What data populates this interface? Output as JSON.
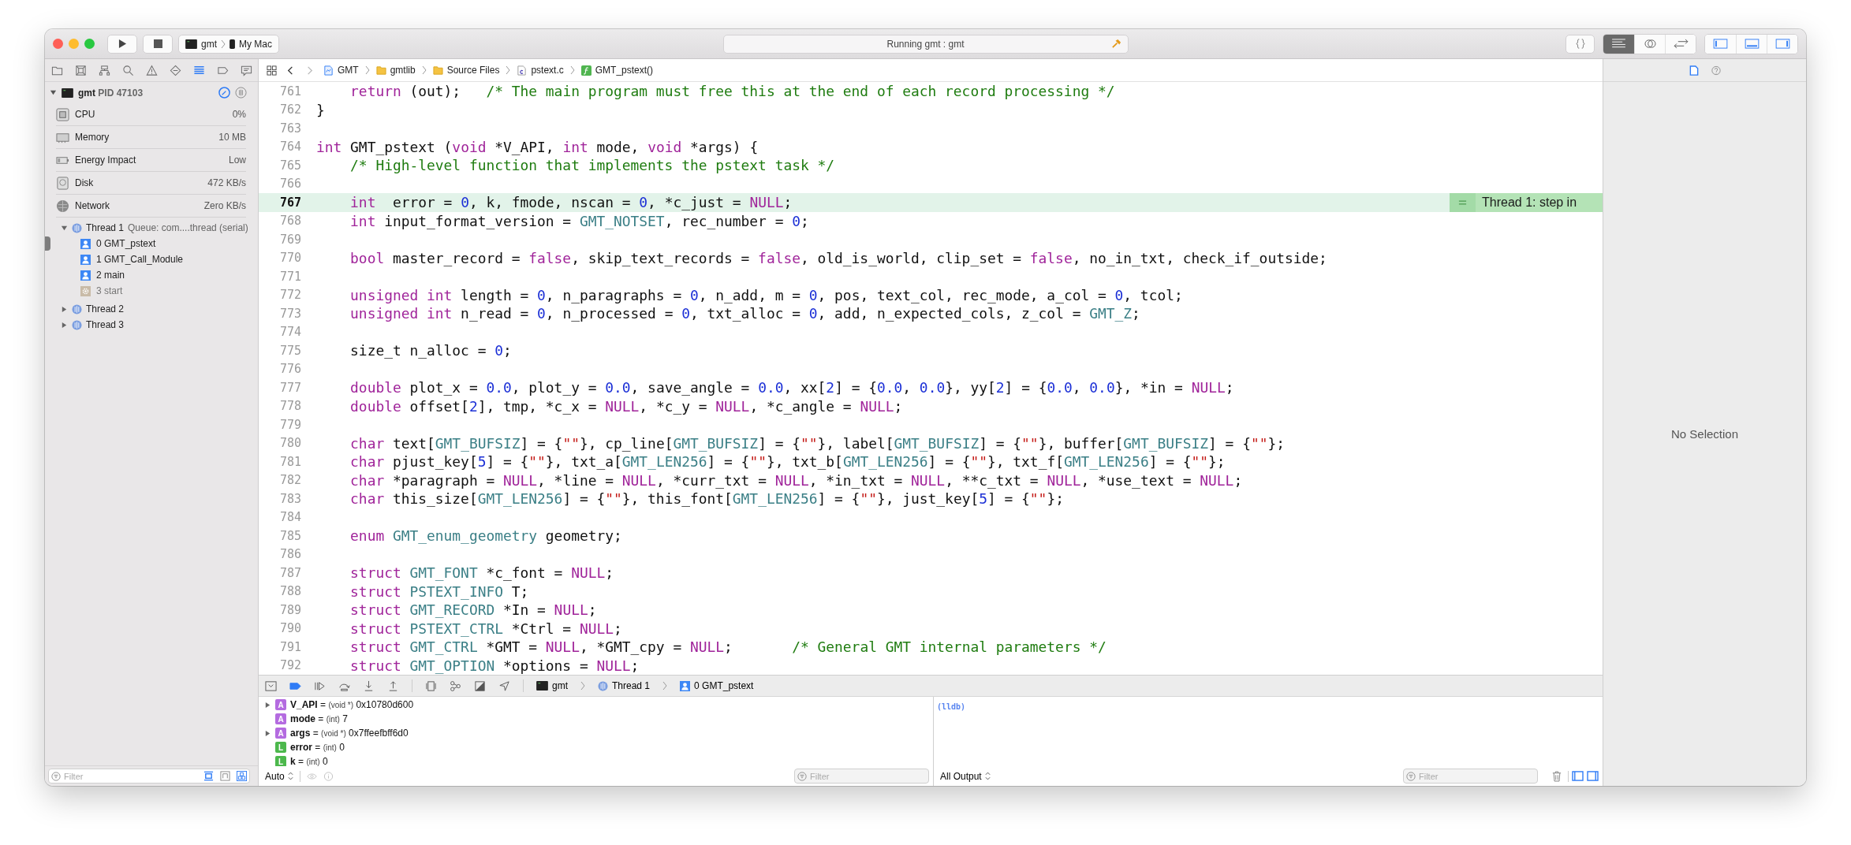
{
  "toolbar": {
    "scheme": {
      "target": "gmt",
      "destination": "My Mac"
    },
    "activity": "Running gmt : gmt",
    "editor_modes": [
      {
        "kind": "standard",
        "selected": true
      },
      {
        "kind": "assistant",
        "selected": false
      },
      {
        "kind": "version",
        "selected": false
      }
    ],
    "panels": [
      {
        "kind": "navigator",
        "on": true
      },
      {
        "kind": "debug",
        "on": true
      },
      {
        "kind": "inspector",
        "on": true
      }
    ]
  },
  "navigator": {
    "tabs": [
      {
        "kind": "project",
        "selected": false
      },
      {
        "kind": "source-control",
        "selected": false
      },
      {
        "kind": "symbol",
        "selected": false
      },
      {
        "kind": "find",
        "selected": false
      },
      {
        "kind": "issue",
        "selected": false
      },
      {
        "kind": "test",
        "selected": false
      },
      {
        "kind": "debug",
        "selected": true
      },
      {
        "kind": "breakpoint",
        "selected": false
      },
      {
        "kind": "report",
        "selected": false
      }
    ],
    "process": {
      "name": "gmt",
      "pid": "PID 47103"
    },
    "gauges": [
      {
        "kind": "cpu",
        "label": "CPU",
        "value": "0%"
      },
      {
        "kind": "memory",
        "label": "Memory",
        "value": "10 MB"
      },
      {
        "kind": "energy",
        "label": "Energy Impact",
        "value": "Low"
      },
      {
        "kind": "disk",
        "label": "Disk",
        "value": "472 KB/s"
      },
      {
        "kind": "network",
        "label": "Network",
        "value": "Zero KB/s"
      }
    ],
    "threads": [
      {
        "name": "Thread 1",
        "detail": "Queue: com....thread (serial)",
        "expanded": true,
        "frames": [
          {
            "label": "0 GMT_pstext",
            "kind": "user",
            "current": true
          },
          {
            "label": "1 GMT_Call_Module",
            "kind": "user",
            "current": false
          },
          {
            "label": "2 main",
            "kind": "user",
            "current": false
          },
          {
            "label": "3 start",
            "kind": "system",
            "current": false
          }
        ]
      },
      {
        "name": "Thread 2",
        "expanded": false
      },
      {
        "name": "Thread 3",
        "expanded": false
      }
    ],
    "filter": {
      "placeholder": "Filter"
    },
    "filter_options": [
      {
        "kind": "crashed",
        "on": true
      },
      {
        "kind": "running",
        "on": false
      },
      {
        "kind": "grouped",
        "on": true
      }
    ]
  },
  "jump_bar": {
    "back_enabled": true,
    "forward_enabled": false,
    "crumbs": [
      {
        "kind": "project",
        "label": "GMT"
      },
      {
        "kind": "folder",
        "label": "gmtlib"
      },
      {
        "kind": "folder",
        "label": "Source Files"
      },
      {
        "kind": "c-file",
        "label": "pstext.c"
      },
      {
        "kind": "function",
        "label": "GMT_pstext()"
      }
    ]
  },
  "editor": {
    "annotation": "Thread 1: step in",
    "lines": [
      {
        "number": "761",
        "current": false,
        "tokens": [
          {
            "kind": "keyword",
            "text": "    return"
          },
          {
            "kind": "plain",
            "text": " (out);   "
          },
          {
            "kind": "comment",
            "text": "/* The main program must free this at the end of each record processing */"
          }
        ]
      },
      {
        "number": "762",
        "current": false,
        "tokens": [
          {
            "kind": "plain",
            "text": "}"
          }
        ]
      },
      {
        "number": "763",
        "current": false
      },
      {
        "number": "764",
        "current": false,
        "tokens": [
          {
            "kind": "keyword",
            "text": "int"
          },
          {
            "kind": "plain",
            "text": " GMT_pstext ("
          },
          {
            "kind": "keyword",
            "text": "void"
          },
          {
            "kind": "plain",
            "text": " *V_API, "
          },
          {
            "kind": "keyword",
            "text": "int"
          },
          {
            "kind": "plain",
            "text": " mode, "
          },
          {
            "kind": "keyword",
            "text": "void"
          },
          {
            "kind": "plain",
            "text": " *args) {"
          }
        ]
      },
      {
        "number": "765",
        "current": false,
        "tokens": [
          {
            "kind": "comment",
            "text": "    /* High-level function that implements the pstext task */"
          }
        ]
      },
      {
        "number": "766",
        "current": false
      },
      {
        "number": "767",
        "current": true,
        "tokens": [
          {
            "kind": "keyword",
            "text": "    int"
          },
          {
            "kind": "plain",
            "text": "  error = "
          },
          {
            "kind": "number",
            "text": "0"
          },
          {
            "kind": "plain",
            "text": ", k, fmode, nscan = "
          },
          {
            "kind": "number",
            "text": "0"
          },
          {
            "kind": "plain",
            "text": ", *c_just = "
          },
          {
            "kind": "keyword",
            "text": "NULL"
          },
          {
            "kind": "plain",
            "text": ";"
          }
        ]
      },
      {
        "number": "768",
        "current": false,
        "tokens": [
          {
            "kind": "keyword",
            "text": "    int"
          },
          {
            "kind": "plain",
            "text": " input_format_version = "
          },
          {
            "kind": "type",
            "text": "GMT_NOTSET"
          },
          {
            "kind": "plain",
            "text": ", rec_number = "
          },
          {
            "kind": "number",
            "text": "0"
          },
          {
            "kind": "plain",
            "text": ";"
          }
        ]
      },
      {
        "number": "769",
        "current": false
      },
      {
        "number": "770",
        "current": false,
        "tokens": [
          {
            "kind": "keyword",
            "text": "    bool"
          },
          {
            "kind": "plain",
            "text": " master_record = "
          },
          {
            "kind": "keyword",
            "text": "false"
          },
          {
            "kind": "plain",
            "text": ", skip_text_records = "
          },
          {
            "kind": "keyword",
            "text": "false"
          },
          {
            "kind": "plain",
            "text": ", old_is_world, clip_set = "
          },
          {
            "kind": "keyword",
            "text": "false"
          },
          {
            "kind": "plain",
            "text": ", no_in_txt, check_if_outside;"
          }
        ]
      },
      {
        "number": "771",
        "current": false
      },
      {
        "number": "772",
        "current": false,
        "tokens": [
          {
            "kind": "keyword",
            "text": "    unsigned int"
          },
          {
            "kind": "plain",
            "text": " length = "
          },
          {
            "kind": "number",
            "text": "0"
          },
          {
            "kind": "plain",
            "text": ", n_paragraphs = "
          },
          {
            "kind": "number",
            "text": "0"
          },
          {
            "kind": "plain",
            "text": ", n_add, m = "
          },
          {
            "kind": "number",
            "text": "0"
          },
          {
            "kind": "plain",
            "text": ", pos, text_col, rec_mode, a_col = "
          },
          {
            "kind": "number",
            "text": "0"
          },
          {
            "kind": "plain",
            "text": ", tcol;"
          }
        ]
      },
      {
        "number": "773",
        "current": false,
        "tokens": [
          {
            "kind": "keyword",
            "text": "    unsigned int"
          },
          {
            "kind": "plain",
            "text": " n_read = "
          },
          {
            "kind": "number",
            "text": "0"
          },
          {
            "kind": "plain",
            "text": ", n_processed = "
          },
          {
            "kind": "number",
            "text": "0"
          },
          {
            "kind": "plain",
            "text": ", txt_alloc = "
          },
          {
            "kind": "number",
            "text": "0"
          },
          {
            "kind": "plain",
            "text": ", add, n_expected_cols, z_col = "
          },
          {
            "kind": "type",
            "text": "GMT_Z"
          },
          {
            "kind": "plain",
            "text": ";"
          }
        ]
      },
      {
        "number": "774",
        "current": false
      },
      {
        "number": "775",
        "current": false,
        "tokens": [
          {
            "kind": "plain",
            "text": "    size_t n_alloc = "
          },
          {
            "kind": "number",
            "text": "0"
          },
          {
            "kind": "plain",
            "text": ";"
          }
        ]
      },
      {
        "number": "776",
        "current": false
      },
      {
        "number": "777",
        "current": false,
        "tokens": [
          {
            "kind": "keyword",
            "text": "    double"
          },
          {
            "kind": "plain",
            "text": " plot_x = "
          },
          {
            "kind": "number",
            "text": "0.0"
          },
          {
            "kind": "plain",
            "text": ", plot_y = "
          },
          {
            "kind": "number",
            "text": "0.0"
          },
          {
            "kind": "plain",
            "text": ", save_angle = "
          },
          {
            "kind": "number",
            "text": "0.0"
          },
          {
            "kind": "plain",
            "text": ", xx["
          },
          {
            "kind": "number",
            "text": "2"
          },
          {
            "kind": "plain",
            "text": "] = {"
          },
          {
            "kind": "number",
            "text": "0.0"
          },
          {
            "kind": "plain",
            "text": ", "
          },
          {
            "kind": "number",
            "text": "0.0"
          },
          {
            "kind": "plain",
            "text": "}, yy["
          },
          {
            "kind": "number",
            "text": "2"
          },
          {
            "kind": "plain",
            "text": "] = {"
          },
          {
            "kind": "number",
            "text": "0.0"
          },
          {
            "kind": "plain",
            "text": ", "
          },
          {
            "kind": "number",
            "text": "0.0"
          },
          {
            "kind": "plain",
            "text": "}, *in = "
          },
          {
            "kind": "keyword",
            "text": "NULL"
          },
          {
            "kind": "plain",
            "text": ";"
          }
        ]
      },
      {
        "number": "778",
        "current": false,
        "tokens": [
          {
            "kind": "keyword",
            "text": "    double"
          },
          {
            "kind": "plain",
            "text": " offset["
          },
          {
            "kind": "number",
            "text": "2"
          },
          {
            "kind": "plain",
            "text": "], tmp, *c_x = "
          },
          {
            "kind": "keyword",
            "text": "NULL"
          },
          {
            "kind": "plain",
            "text": ", *c_y = "
          },
          {
            "kind": "keyword",
            "text": "NULL"
          },
          {
            "kind": "plain",
            "text": ", *c_angle = "
          },
          {
            "kind": "keyword",
            "text": "NULL"
          },
          {
            "kind": "plain",
            "text": ";"
          }
        ]
      },
      {
        "number": "779",
        "current": false
      },
      {
        "number": "780",
        "current": false,
        "tokens": [
          {
            "kind": "keyword",
            "text": "    char"
          },
          {
            "kind": "plain",
            "text": " text["
          },
          {
            "kind": "type",
            "text": "GMT_BUFSIZ"
          },
          {
            "kind": "plain",
            "text": "] = {"
          },
          {
            "kind": "string",
            "text": "\"\""
          },
          {
            "kind": "plain",
            "text": "}, cp_line["
          },
          {
            "kind": "type",
            "text": "GMT_BUFSIZ"
          },
          {
            "kind": "plain",
            "text": "] = {"
          },
          {
            "kind": "string",
            "text": "\"\""
          },
          {
            "kind": "plain",
            "text": "}, label["
          },
          {
            "kind": "type",
            "text": "GMT_BUFSIZ"
          },
          {
            "kind": "plain",
            "text": "] = {"
          },
          {
            "kind": "string",
            "text": "\"\""
          },
          {
            "kind": "plain",
            "text": "}, buffer["
          },
          {
            "kind": "type",
            "text": "GMT_BUFSIZ"
          },
          {
            "kind": "plain",
            "text": "] = {"
          },
          {
            "kind": "string",
            "text": "\"\""
          },
          {
            "kind": "plain",
            "text": "};"
          }
        ]
      },
      {
        "number": "781",
        "current": false,
        "tokens": [
          {
            "kind": "keyword",
            "text": "    char"
          },
          {
            "kind": "plain",
            "text": " pjust_key["
          },
          {
            "kind": "number",
            "text": "5"
          },
          {
            "kind": "plain",
            "text": "] = {"
          },
          {
            "kind": "string",
            "text": "\"\""
          },
          {
            "kind": "plain",
            "text": "}, txt_a["
          },
          {
            "kind": "type",
            "text": "GMT_LEN256"
          },
          {
            "kind": "plain",
            "text": "] = {"
          },
          {
            "kind": "string",
            "text": "\"\""
          },
          {
            "kind": "plain",
            "text": "}, txt_b["
          },
          {
            "kind": "type",
            "text": "GMT_LEN256"
          },
          {
            "kind": "plain",
            "text": "] = {"
          },
          {
            "kind": "string",
            "text": "\"\""
          },
          {
            "kind": "plain",
            "text": "}, txt_f["
          },
          {
            "kind": "type",
            "text": "GMT_LEN256"
          },
          {
            "kind": "plain",
            "text": "] = {"
          },
          {
            "kind": "string",
            "text": "\"\""
          },
          {
            "kind": "plain",
            "text": "};"
          }
        ]
      },
      {
        "number": "782",
        "current": false,
        "tokens": [
          {
            "kind": "keyword",
            "text": "    char"
          },
          {
            "kind": "plain",
            "text": " *paragraph = "
          },
          {
            "kind": "keyword",
            "text": "NULL"
          },
          {
            "kind": "plain",
            "text": ", *line = "
          },
          {
            "kind": "keyword",
            "text": "NULL"
          },
          {
            "kind": "plain",
            "text": ", *curr_txt = "
          },
          {
            "kind": "keyword",
            "text": "NULL"
          },
          {
            "kind": "plain",
            "text": ", *in_txt = "
          },
          {
            "kind": "keyword",
            "text": "NULL"
          },
          {
            "kind": "plain",
            "text": ", **c_txt = "
          },
          {
            "kind": "keyword",
            "text": "NULL"
          },
          {
            "kind": "plain",
            "text": ", *use_text = "
          },
          {
            "kind": "keyword",
            "text": "NULL"
          },
          {
            "kind": "plain",
            "text": ";"
          }
        ]
      },
      {
        "number": "783",
        "current": false,
        "tokens": [
          {
            "kind": "keyword",
            "text": "    char"
          },
          {
            "kind": "plain",
            "text": " this_size["
          },
          {
            "kind": "type",
            "text": "GMT_LEN256"
          },
          {
            "kind": "plain",
            "text": "] = {"
          },
          {
            "kind": "string",
            "text": "\"\""
          },
          {
            "kind": "plain",
            "text": "}, this_font["
          },
          {
            "kind": "type",
            "text": "GMT_LEN256"
          },
          {
            "kind": "plain",
            "text": "] = {"
          },
          {
            "kind": "string",
            "text": "\"\""
          },
          {
            "kind": "plain",
            "text": "}, just_key["
          },
          {
            "kind": "number",
            "text": "5"
          },
          {
            "kind": "plain",
            "text": "] = {"
          },
          {
            "kind": "string",
            "text": "\"\""
          },
          {
            "kind": "plain",
            "text": "};"
          }
        ]
      },
      {
        "number": "784",
        "current": false
      },
      {
        "number": "785",
        "current": false,
        "tokens": [
          {
            "kind": "keyword",
            "text": "    enum "
          },
          {
            "kind": "type",
            "text": "GMT_enum_geometry"
          },
          {
            "kind": "plain",
            "text": " geometry;"
          }
        ]
      },
      {
        "number": "786",
        "current": false
      },
      {
        "number": "787",
        "current": false,
        "tokens": [
          {
            "kind": "keyword",
            "text": "    struct "
          },
          {
            "kind": "type",
            "text": "GMT_FONT"
          },
          {
            "kind": "plain",
            "text": " *c_font = "
          },
          {
            "kind": "keyword",
            "text": "NULL"
          },
          {
            "kind": "plain",
            "text": ";"
          }
        ]
      },
      {
        "number": "788",
        "current": false,
        "tokens": [
          {
            "kind": "keyword",
            "text": "    struct "
          },
          {
            "kind": "type",
            "text": "PSTEXT_INFO"
          },
          {
            "kind": "plain",
            "text": " T;"
          }
        ]
      },
      {
        "number": "789",
        "current": false,
        "tokens": [
          {
            "kind": "keyword",
            "text": "    struct "
          },
          {
            "kind": "type",
            "text": "GMT_RECORD"
          },
          {
            "kind": "plain",
            "text": " *In = "
          },
          {
            "kind": "keyword",
            "text": "NULL"
          },
          {
            "kind": "plain",
            "text": ";"
          }
        ]
      },
      {
        "number": "790",
        "current": false,
        "tokens": [
          {
            "kind": "keyword",
            "text": "    struct "
          },
          {
            "kind": "type",
            "text": "PSTEXT_CTRL"
          },
          {
            "kind": "plain",
            "text": " *Ctrl = "
          },
          {
            "kind": "keyword",
            "text": "NULL"
          },
          {
            "kind": "plain",
            "text": ";"
          }
        ]
      },
      {
        "number": "791",
        "current": false,
        "tokens": [
          {
            "kind": "keyword",
            "text": "    struct "
          },
          {
            "kind": "type",
            "text": "GMT_CTRL"
          },
          {
            "kind": "plain",
            "text": " *GMT = "
          },
          {
            "kind": "keyword",
            "text": "NULL"
          },
          {
            "kind": "plain",
            "text": ", *GMT_cpy = "
          },
          {
            "kind": "keyword",
            "text": "NULL"
          },
          {
            "kind": "plain",
            "text": ";       "
          },
          {
            "kind": "comment",
            "text": "/* General GMT internal parameters */"
          }
        ]
      },
      {
        "number": "792",
        "current": false,
        "tokens": [
          {
            "kind": "keyword",
            "text": "    struct "
          },
          {
            "kind": "type",
            "text": "GMT_OPTION"
          },
          {
            "kind": "plain",
            "text": " *options = "
          },
          {
            "kind": "keyword",
            "text": "NULL"
          },
          {
            "kind": "plain",
            "text": ";"
          }
        ]
      }
    ]
  },
  "debug_bar": {
    "breakpoints_active": true,
    "crumbs": [
      {
        "kind": "process",
        "label": "gmt"
      },
      {
        "kind": "thread",
        "label": "Thread 1"
      },
      {
        "kind": "frame",
        "label": "0 GMT_pstext"
      }
    ]
  },
  "variables": {
    "mode": "Auto",
    "filter": {
      "placeholder": "Filter"
    },
    "rows": [
      {
        "kind": "argument",
        "badge": "A",
        "name": "V_API",
        "operator": "=",
        "type": "(void *)",
        "value": "0x10780d600",
        "expandable": true
      },
      {
        "kind": "argument",
        "badge": "A",
        "name": "mode",
        "operator": "=",
        "type": "(int)",
        "value": "7",
        "expandable": false
      },
      {
        "kind": "argument",
        "badge": "A",
        "name": "args",
        "operator": "=",
        "type": "(void *)",
        "value": "0x7ffeefbff6d0",
        "expandable": true
      },
      {
        "kind": "local",
        "badge": "L",
        "name": "error",
        "operator": "=",
        "type": "(int)",
        "value": "0",
        "expandable": false
      },
      {
        "kind": "local",
        "badge": "L",
        "name": "k",
        "operator": "=",
        "type": "(int)",
        "value": "0",
        "expandable": false
      }
    ]
  },
  "console": {
    "prompt": "(lldb)",
    "output_mode": "All Output",
    "filter": {
      "placeholder": "Filter"
    }
  },
  "inspector": {
    "tabs": [
      {
        "kind": "file",
        "selected": true
      },
      {
        "kind": "help",
        "selected": false
      }
    ],
    "message": "No Selection"
  }
}
